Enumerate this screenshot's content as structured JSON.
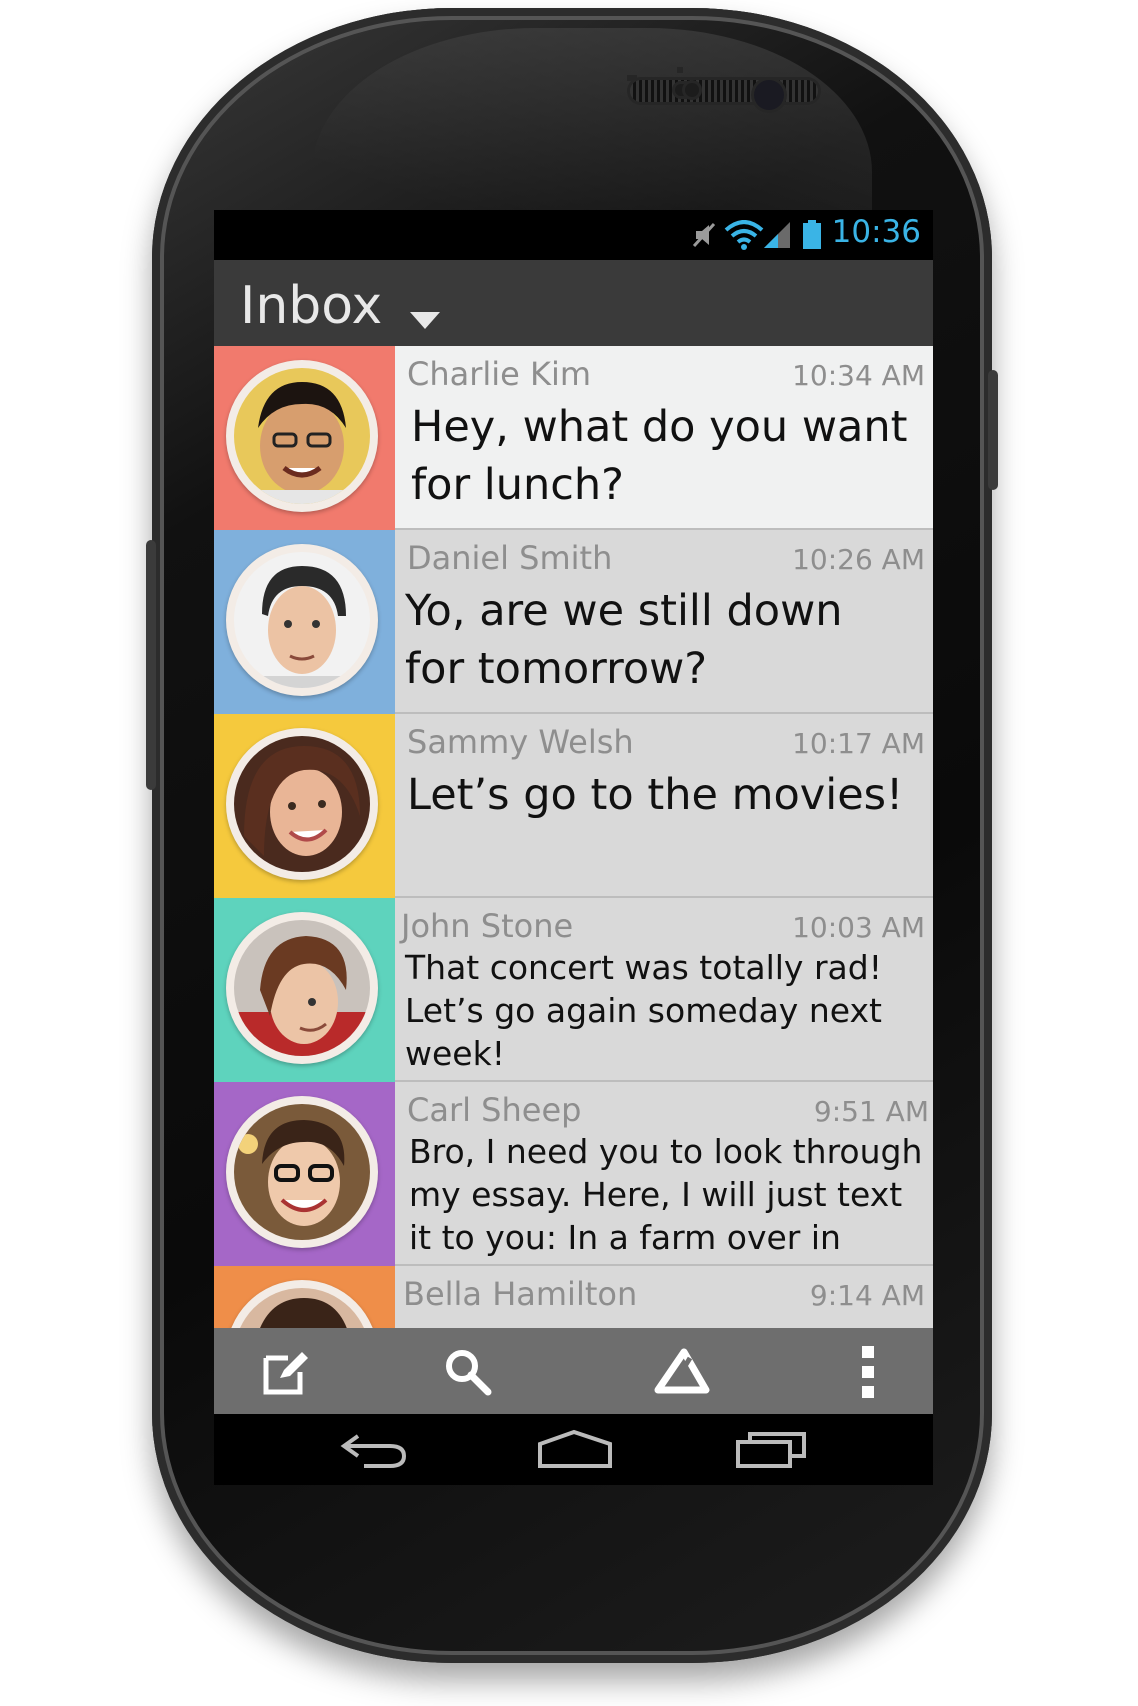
{
  "status": {
    "time": "10:36"
  },
  "header": {
    "title": "Inbox"
  },
  "colors": {
    "accent": "#3ab4e6",
    "stripes": [
      "#f17a6d",
      "#7fb0dc",
      "#f5c93d",
      "#5ed3bd",
      "#a567c7",
      "#ef8e49"
    ]
  },
  "messages": [
    {
      "sender": "Charlie Kim",
      "time": "10:34 AM",
      "text": "Hey, what do you want for lunch?"
    },
    {
      "sender": "Daniel Smith",
      "time": "10:26 AM",
      "text": "Yo, are we still down for tomorrow?"
    },
    {
      "sender": "Sammy Welsh",
      "time": "10:17 AM",
      "text": "Let’s go to the movies!"
    },
    {
      "sender": "John Stone",
      "time": "10:03 AM",
      "text": "That concert was totally rad! Let’s go again someday next week!"
    },
    {
      "sender": "Carl Sheep",
      "time": "9:51 AM",
      "text": "Bro, I need you to look through my essay. Here, I will just text it to you: In a farm over in Nebr..."
    },
    {
      "sender": "Bella Hamilton",
      "time": "9:14 AM",
      "text": ""
    }
  ],
  "toolbar": {
    "icons": [
      "compose-icon",
      "search-icon",
      "delta-icon",
      "overflow-menu-icon"
    ]
  },
  "navbar": {
    "icons": [
      "back-icon",
      "home-icon",
      "recent-apps-icon"
    ]
  }
}
